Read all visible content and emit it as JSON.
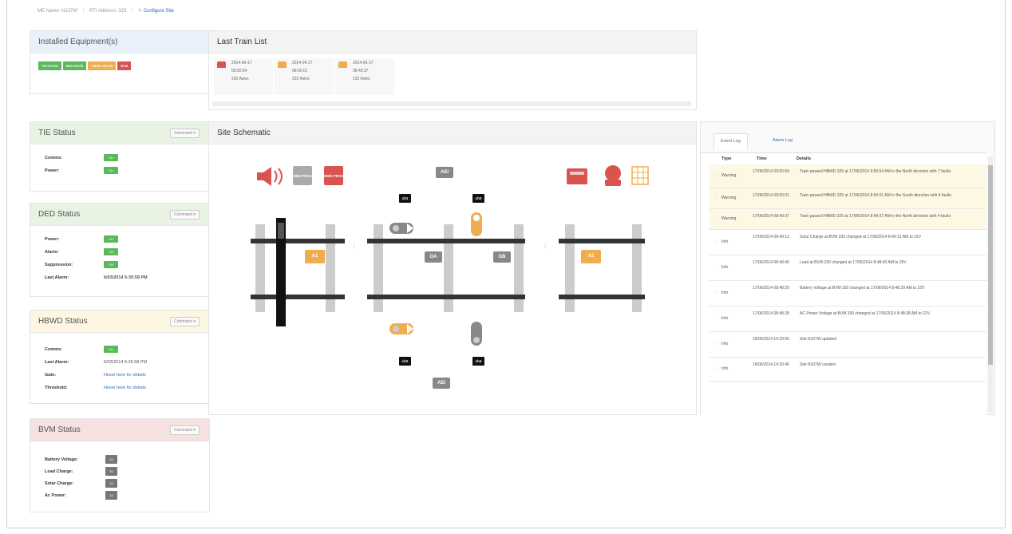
{
  "breadcrumb": {
    "site_name_label": "ME Name:",
    "site_name": "N107W",
    "ip_label": "RTI Address:",
    "ip": "323",
    "configure": "Configure Site"
  },
  "installed": {
    "title": "Installed Equipment(s)",
    "tags": [
      {
        "label": "TIE N107W",
        "color": "#5cb85c"
      },
      {
        "label": "DED N107E",
        "color": "#5cb85c"
      },
      {
        "label": "HBWD N107W",
        "color": "#f0ad4e"
      },
      {
        "label": "BVM",
        "color": "#d9534f"
      }
    ]
  },
  "last_train": {
    "title": "Last Train List",
    "items": [
      {
        "date": "2014-06-17",
        "time": "09:50:54",
        "axles": "232 Axles",
        "icon_color": "#d9534f"
      },
      {
        "date": "2014-06-17",
        "time": "08:50:01",
        "axles": "232 Axles",
        "icon_color": "#f0ad4e"
      },
      {
        "date": "2014-06-17",
        "time": "08:49:37",
        "axles": "232 Axles",
        "icon_color": "#f0ad4e"
      }
    ]
  },
  "tie": {
    "title": "TIE Status",
    "command": "Command ▾",
    "comms_label": "Comms:",
    "comms": "On",
    "power_label": "Power:",
    "power": "On"
  },
  "ded": {
    "title": "DED Status",
    "command": "Command ▾",
    "power_label": "Power:",
    "power": "On",
    "alarm_label": "Alarm:",
    "alarm": "Off",
    "suppression_label": "Suppression:",
    "suppression": "Off",
    "last_alarm_label": "Last Alarm:",
    "last_alarm": "6/03/2014 5:35:59 PM"
  },
  "hbwd": {
    "title": "HBWD Status",
    "command": "Command ▾",
    "comms_label": "Comms:",
    "comms": "On",
    "last_alarm_label": "Last Alarm:",
    "last_alarm": "6/03/2014 5:25:58 PM",
    "gate_label": "Gate:",
    "gate": "Hover here for details",
    "threshold_label": "Threshold:",
    "threshold": "Hover here for details"
  },
  "bvm": {
    "title": "BVM Status",
    "command": "Command ▾",
    "battery_label": "Battery Voltage:",
    "battery": "22",
    "load_label": "Load Charge:",
    "load": "20",
    "solar_label": "Solar Charge:",
    "solar": "22",
    "ac_label": "Ac Power:",
    "ac": "22"
  },
  "schematic": {
    "title": "Site Schematic",
    "hbd_label": "HBD PROX",
    "hwd_label": "HWD PROX",
    "ch1": "ch1",
    "ch2": "ch2",
    "ch3": "ch3",
    "ch4": "ch4",
    "aei_top": "AEI",
    "aei_bottom": "AEI",
    "a1": "A1",
    "a2": "A2",
    "ga": "GA",
    "gb": "GB"
  },
  "events": {
    "tab_event": "Event Log",
    "tab_alarm": "Alarm Log",
    "col_type": "Type",
    "col_time": "Time",
    "col_details": "Details",
    "rows": [
      {
        "type": "Warning",
        "time": "17/06/2014 09:50:54",
        "details": "Train passed HBWD 325 at 17/06/2014 9:50:54 AM in the North direction with 7 faults",
        "warn": true
      },
      {
        "type": "Warning",
        "time": "17/06/2014 08:50:01",
        "details": "Train passed HBWD 325 at 17/06/2014 8:50:01 AM in the South direction with 4 faults",
        "warn": true
      },
      {
        "type": "Warning",
        "time": "17/06/2014 08:49:37",
        "details": "Train passed HBWD 325 at 17/06/2014 8:49:37 AM in the North direction with 4 faults",
        "warn": true
      },
      {
        "type": "Info",
        "time": "17/06/2014 09:49:12",
        "details": "Solar Charge at BVM 330 changed at 17/06/2014 8:49:12 AM to 22V",
        "warn": false
      },
      {
        "type": "Info",
        "time": "17/06/2014 08:48:40",
        "details": "Load at BVM 330 changed at 17/06/2014 8:48:40 AM to 20V",
        "warn": false
      },
      {
        "type": "Info",
        "time": "17/06/2014 08:48:29",
        "details": "Battery Voltage at BVM 330 changed at 17/06/2014 8:48:29 AM to 22V",
        "warn": false
      },
      {
        "type": "Info",
        "time": "17/06/2014 08:48:28",
        "details": "AC Power Voltage at BVM 330 changed at 17/06/2014 8:48:28 AM to 22V",
        "warn": false
      },
      {
        "type": "Info",
        "time": "16/06/2014 14:29:56",
        "details": "Site N107W updated",
        "warn": false
      },
      {
        "type": "Info",
        "time": "16/06/2014 14:29:46",
        "details": "Site N107W created",
        "warn": false
      }
    ]
  },
  "colors": {
    "green": "#5cb85c",
    "orange": "#f0ad4e",
    "red": "#d9534f",
    "link": "#2a6db5"
  }
}
